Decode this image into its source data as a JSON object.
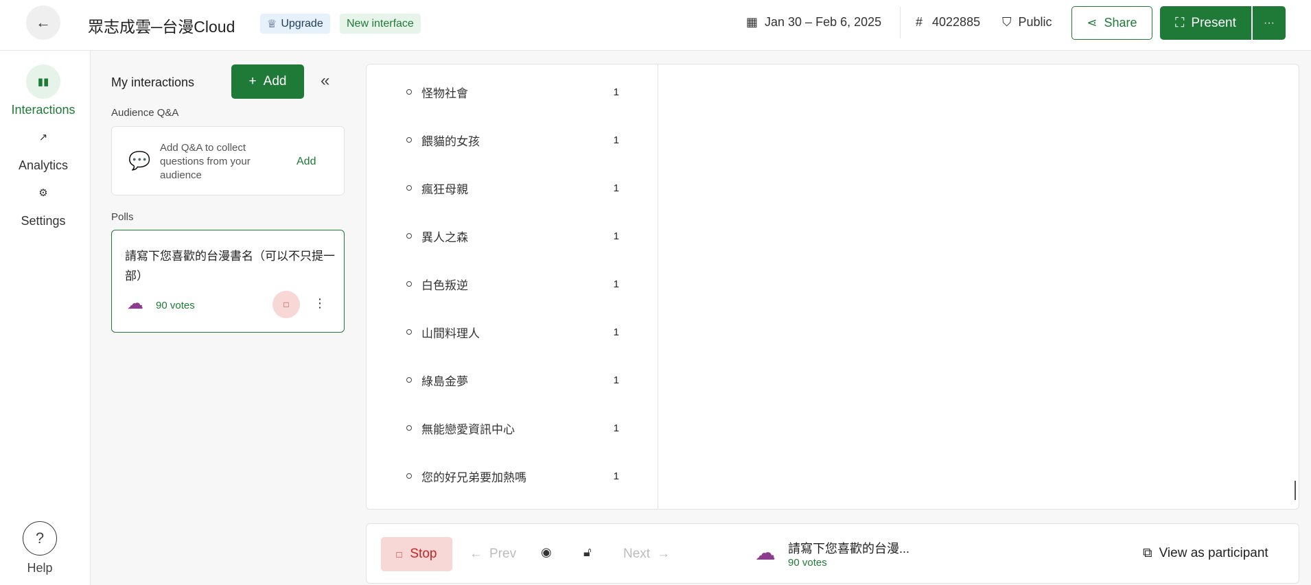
{
  "header": {
    "back_label": "←",
    "title": "眾志成雲─台漫Cloud",
    "upgrade": "Upgrade",
    "new_interface": "New interface",
    "date_range": "Jan 30 – Feb 6, 2025",
    "code_prefix": "#",
    "code": "4022885",
    "visibility": "Public",
    "share": "Share",
    "present": "Present",
    "more": "···"
  },
  "nav": {
    "interactions": "Interactions",
    "analytics": "Analytics",
    "settings": "Settings",
    "help": "Help"
  },
  "panel": {
    "title": "My interactions",
    "add": "Add",
    "qa_label": "Audience Q&A",
    "qa_text": "Add Q&A to collect questions from your audience",
    "qa_add": "Add",
    "polls_label": "Polls",
    "poll_title": "請寫下您喜歡的台漫書名（可以不只提一部）",
    "poll_votes": "90 votes"
  },
  "results": [
    {
      "label": "怪物社會",
      "count": "1"
    },
    {
      "label": "餵貓的女孩",
      "count": "1"
    },
    {
      "label": "瘋狂母親",
      "count": "1"
    },
    {
      "label": "異人之森",
      "count": "1"
    },
    {
      "label": "白色叛逆",
      "count": "1"
    },
    {
      "label": "山間料理人",
      "count": "1"
    },
    {
      "label": "綠島金夢",
      "count": "1"
    },
    {
      "label": "無能戀愛資訊中心",
      "count": "1"
    },
    {
      "label": "您的好兄弟要加熱嗎",
      "count": "1"
    }
  ],
  "bottom": {
    "stop": "Stop",
    "prev": "Prev",
    "next": "Next",
    "poll_title": "請寫下您喜歡的台漫...",
    "votes": "90 votes",
    "view_as_participant": "View as participant"
  }
}
